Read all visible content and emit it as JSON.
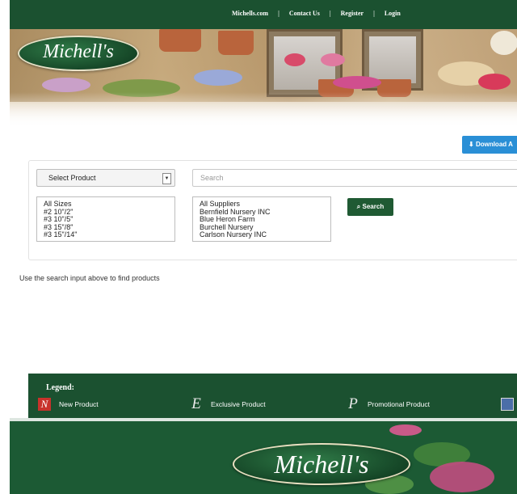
{
  "topnav": {
    "links": [
      "Michells.com",
      "Contact Us",
      "Register",
      "Login"
    ],
    "separator": "|"
  },
  "header": {
    "logo_text": "Michell's"
  },
  "toolbar": {
    "download_label": "Download A",
    "download_icon": "download-icon"
  },
  "filters": {
    "product_select": "Select Product",
    "search_placeholder": "Search",
    "sizes": [
      "All Sizes",
      "#2 10\"/2\"",
      "#3 10\"/5\"",
      "#3 15\"/8\"",
      "#3 15\"/14\""
    ],
    "suppliers": [
      "All Suppliers",
      "Bernfield Nursery INC",
      "Blue Heron Farm",
      "Burchell Nursery",
      "Carlson Nursery INC"
    ],
    "search_button": "Search",
    "search_icon": "magnifier-icon"
  },
  "main": {
    "hint": "Use the search input above to find products"
  },
  "legend": {
    "title": "Legend:",
    "items": [
      {
        "glyph": "N",
        "label": "New Product"
      },
      {
        "glyph": "E",
        "label": "Exclusive Product"
      },
      {
        "glyph": "P",
        "label": "Promotional Product"
      },
      {
        "glyph": "",
        "label": ""
      }
    ]
  },
  "footer": {
    "logo_text": "Michell's"
  },
  "colors": {
    "brand_green": "#1b5130",
    "download_blue": "#2a8fd6",
    "new_red": "#c8322b"
  }
}
